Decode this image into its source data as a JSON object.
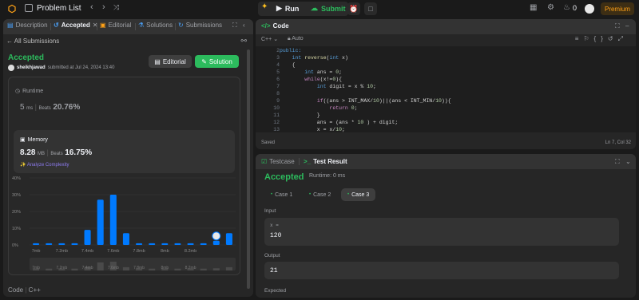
{
  "topbar": {
    "problem_list": "Problem List",
    "run": "Run",
    "submit": "Submit",
    "streak": "0",
    "premium": "Premium"
  },
  "left_tabs": [
    {
      "label": "Description"
    },
    {
      "label": "Accepted"
    },
    {
      "label": "Editorial"
    },
    {
      "label": "Solutions"
    },
    {
      "label": "Submissions"
    }
  ],
  "submission": {
    "back": "All Submissions",
    "status": "Accepted",
    "user": "sheikhjawad",
    "submitted_text": "submitted at Jul 24, 2024 13:40",
    "editorial_btn": "Editorial",
    "solution_btn": "Solution",
    "runtime_label": "Runtime",
    "runtime_value": "5",
    "runtime_unit": "ms",
    "beats_label": "Beats",
    "runtime_beats": "20.76%",
    "memory_label": "Memory",
    "memory_value": "8.28",
    "memory_unit": "MB",
    "memory_beats": "16.75%",
    "analyze": "Analyze Complexity",
    "footer_code": "Code",
    "footer_lang": "C++"
  },
  "chart_data": {
    "type": "bar",
    "title": "",
    "xlabel": "",
    "ylabel": "",
    "y_ticks": [
      "40%",
      "30%",
      "20%",
      "10%",
      "0%"
    ],
    "ylim": [
      0,
      40
    ],
    "x_tick_labels": [
      "7mb",
      "7.2mb",
      "7.4mb",
      "7.6mb",
      "7.8mb",
      "8mb",
      "8.2mb"
    ],
    "values": [
      1,
      1,
      1,
      1,
      9,
      27,
      30,
      7,
      1,
      1,
      1,
      1,
      1,
      1,
      2.5,
      7
    ],
    "highlight_index": 14,
    "bar_color": "#007aff",
    "grid": true
  },
  "editor": {
    "tab": "Code",
    "language": "C++",
    "autocomplete": "Auto",
    "lines": [
      {
        "n": "2",
        "t": "public:"
      },
      {
        "n": "3",
        "t": "    int reverse(int x)"
      },
      {
        "n": "4",
        "t": "    {"
      },
      {
        "n": "5",
        "t": "        int ans = 0;"
      },
      {
        "n": "6",
        "t": "        while(x!=0){"
      },
      {
        "n": "7",
        "t": "            int digit = x % 10;"
      },
      {
        "n": "8",
        "t": ""
      },
      {
        "n": "9",
        "t": "            if((ans > INT_MAX/10)||(ans < INT_MIN/10)){"
      },
      {
        "n": "10",
        "t": "                return 0;"
      },
      {
        "n": "11",
        "t": "            }"
      },
      {
        "n": "12",
        "t": "            ans = (ans * 10 ) + digit;"
      },
      {
        "n": "13",
        "t": "            x = x/10;"
      }
    ],
    "saved": "Saved",
    "cursor": "Ln 7, Col 32"
  },
  "tests": {
    "tab_testcase": "Testcase",
    "tab_result": "Test Result",
    "status": "Accepted",
    "runtime": "Runtime: 0 ms",
    "cases": [
      "Case 1",
      "Case 2",
      "Case 3"
    ],
    "input_label": "Input",
    "input_var": "x =",
    "input_value": "120",
    "output_label": "Output",
    "output_value": "21",
    "expected_label": "Expected"
  }
}
